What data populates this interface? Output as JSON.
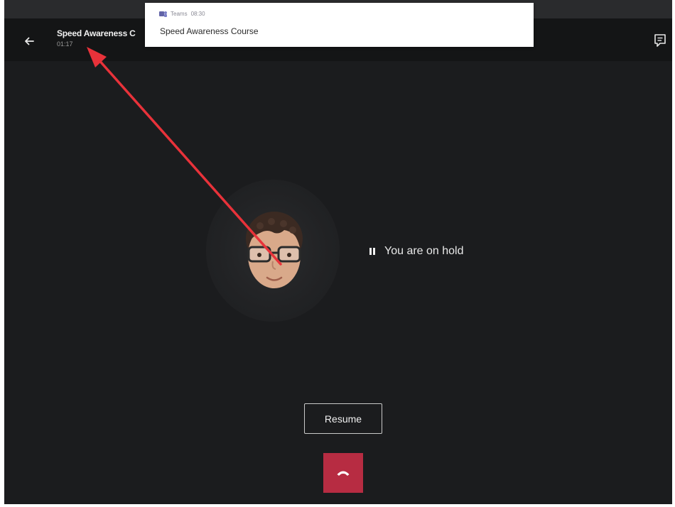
{
  "header": {
    "title": "Speed Awareness C",
    "timer": "01:17"
  },
  "notification": {
    "app": "Teams",
    "time": "08:30",
    "message": "Speed Awareness Course"
  },
  "call": {
    "status": "You are on hold",
    "resume_label": "Resume"
  },
  "colors": {
    "background": "#1b1c1e",
    "topbar": "#141516",
    "hangup": "#b72c42",
    "annotation_arrow": "#e8323a",
    "teams_brand": "#6264a7"
  },
  "icons": {
    "back": "arrow-left-icon",
    "chat": "chat-icon",
    "teams": "teams-logo-icon",
    "pause": "pause-icon",
    "hangup": "phone-hangup-icon"
  }
}
